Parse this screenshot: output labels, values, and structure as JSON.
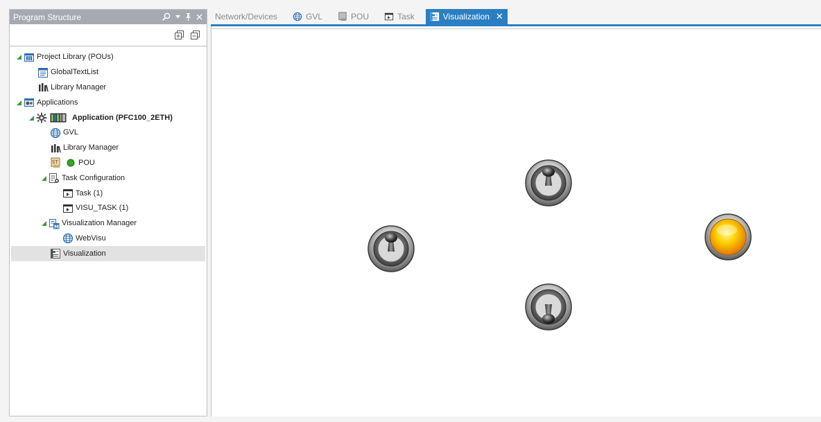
{
  "pane": {
    "title": "Program Structure",
    "icons": [
      "search-icon",
      "dropdown-icon",
      "pin-icon",
      "close-icon"
    ],
    "toolbar": [
      "expand-all-icon",
      "collapse-all-icon"
    ]
  },
  "tree": [
    {
      "label": "Project Library (POUs)",
      "icon": "library-folder-icon",
      "expanded": true
    },
    {
      "label": "GlobalTextList",
      "icon": "text-list-icon"
    },
    {
      "label": "Library Manager",
      "icon": "library-manager-icon"
    },
    {
      "label": "Applications",
      "icon": "applications-folder-icon",
      "expanded": true
    },
    {
      "label": "Application (PFC100_2ETH)",
      "icon": "application-gear-icon",
      "expanded": true,
      "bold": true
    },
    {
      "label": "GVL",
      "icon": "globe-icon"
    },
    {
      "label": "Library Manager",
      "icon": "library-manager-icon"
    },
    {
      "label": "POU",
      "icon": "pou-icon"
    },
    {
      "label": "Task Configuration",
      "icon": "task-config-icon",
      "expanded": true
    },
    {
      "label": "Task (1)",
      "icon": "task-icon"
    },
    {
      "label": "VISU_TASK (1)",
      "icon": "task-icon"
    },
    {
      "label": "Visualization Manager",
      "icon": "visu-manager-icon",
      "expanded": true
    },
    {
      "label": "WebVisu",
      "icon": "globe-icon"
    },
    {
      "label": "Visualization",
      "icon": "visualization-icon",
      "selected": true
    }
  ],
  "tabs": [
    {
      "label": "Network/Devices",
      "icon": ""
    },
    {
      "label": "GVL",
      "icon": "globe-icon"
    },
    {
      "label": "POU",
      "icon": "pou-icon"
    },
    {
      "label": "Task",
      "icon": "task-icon"
    },
    {
      "label": "Visualization",
      "icon": "visualization-icon",
      "active": true
    }
  ],
  "colors": {
    "accent": "#2a7fc3",
    "pane_header": "#a6aab0",
    "lamp": "#f5c400",
    "status_dot": "#34a81a"
  },
  "canvas": {
    "widgets": [
      "toggle-switch-up",
      "toggle-switch-left",
      "toggle-switch-down",
      "indicator-lamp-on"
    ]
  }
}
